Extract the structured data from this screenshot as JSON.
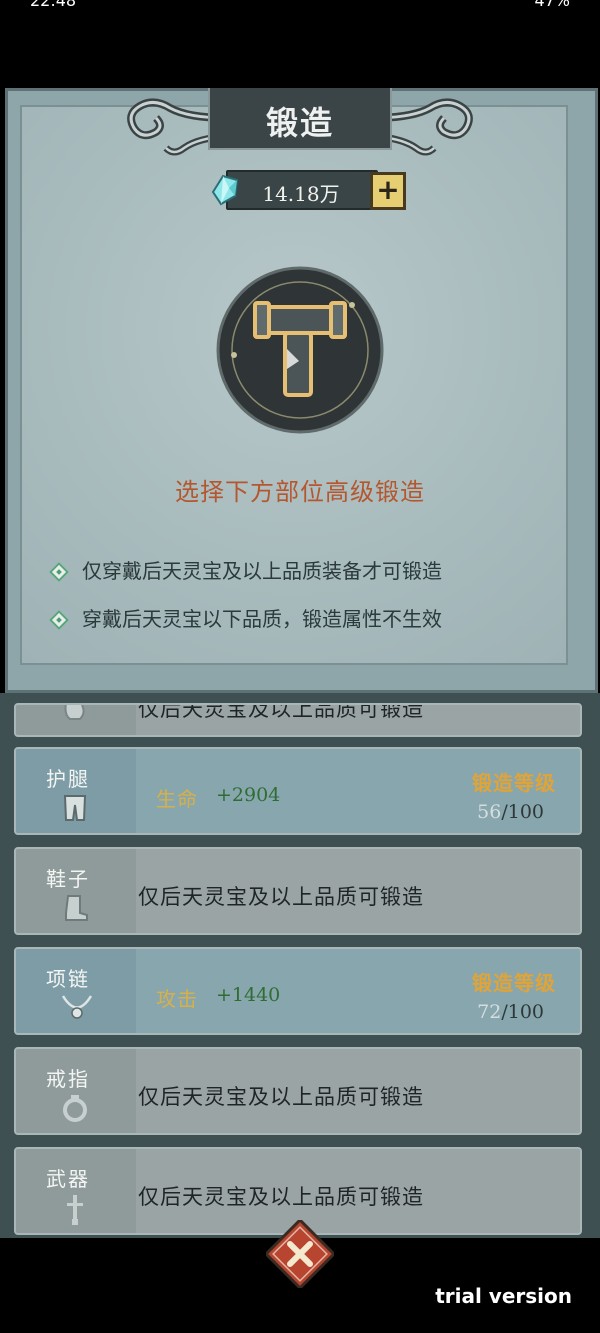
{
  "status_bar": {
    "time": "22:48",
    "battery": "47%"
  },
  "header": {
    "title": "锻造"
  },
  "currency": {
    "icon": "crystal-icon",
    "value": "14.18万",
    "add_label": "+"
  },
  "forge": {
    "caption": "选择下方部位高级锻造",
    "rules": [
      "仅穿戴后天灵宝及以上品质装备才可锻造",
      "穿戴后天灵宝以下品质，锻造属性不生效"
    ]
  },
  "slots": [
    {
      "name": "",
      "icon": "glove-icon",
      "locked_text": "仅后天灵宝及以上品质可锻造"
    },
    {
      "name": "护腿",
      "icon": "leggings-icon",
      "stat_name": "生命",
      "stat_value": "+2904",
      "level_label": "锻造等级",
      "level_current": "56",
      "level_max": "/100"
    },
    {
      "name": "鞋子",
      "icon": "boot-icon",
      "locked_text": "仅后天灵宝及以上品质可锻造"
    },
    {
      "name": "项链",
      "icon": "necklace-icon",
      "stat_name": "攻击",
      "stat_value": "+1440",
      "level_label": "锻造等级",
      "level_current": "72",
      "level_max": "/100"
    },
    {
      "name": "戒指",
      "icon": "ring-icon",
      "locked_text": "仅后天灵宝及以上品质可锻造"
    },
    {
      "name": "武器",
      "icon": "sword-icon",
      "locked_text": "仅后天灵宝及以上品质可锻造"
    }
  ],
  "footer": {
    "close_icon": "close-icon",
    "watermark": "trial version"
  },
  "colors": {
    "accent_gold": "#e6cf73",
    "caption_orange": "#b4572f",
    "stat_green": "#2f6d32",
    "close_red": "#b8452f"
  }
}
